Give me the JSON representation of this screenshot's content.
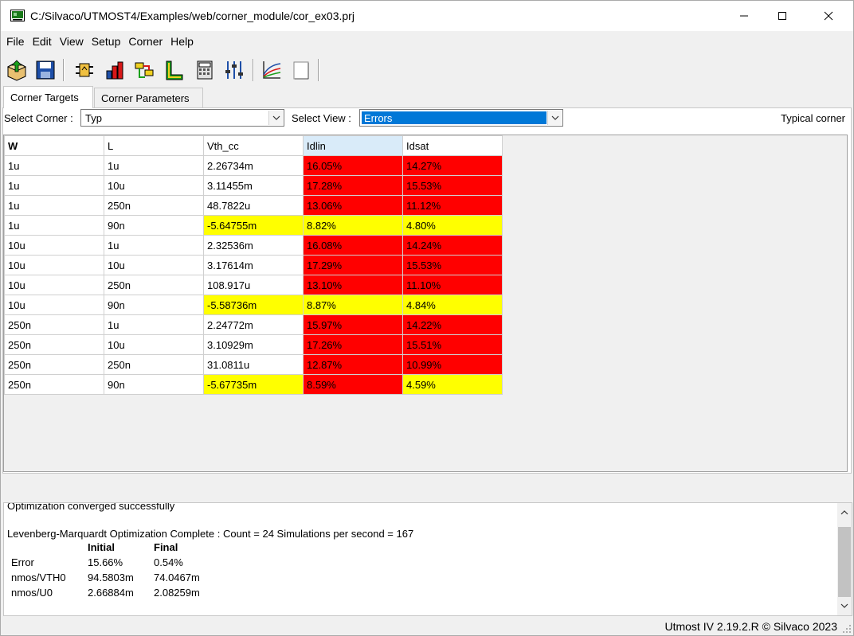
{
  "window": {
    "title": "C:/Silvaco/UTMOST4/Examples/web/corner_module/cor_ex03.prj"
  },
  "menu": [
    "File",
    "Edit",
    "View",
    "Setup",
    "Corner",
    "Help"
  ],
  "toolbar": {
    "icons": [
      "open-project-icon",
      "save-icon",
      "module-icon",
      "bar-chart-icon",
      "flow-icon",
      "l-shape-icon",
      "calculator-icon",
      "sliders-icon",
      "plot-icon",
      "blank-page-icon"
    ]
  },
  "tabs": [
    {
      "label": "Corner Targets",
      "active": true
    },
    {
      "label": "Corner Parameters",
      "active": false
    }
  ],
  "select_corner": {
    "label": "Select Corner :",
    "value": "Typ"
  },
  "select_view": {
    "label": "Select View :",
    "value": "Errors"
  },
  "typical_corner_label": "Typical corner",
  "grid": {
    "headers": [
      "W",
      "L",
      "Vth_cc",
      "Idlin",
      "Idsat"
    ],
    "rows": [
      {
        "cells": [
          "1u",
          "1u",
          "2.26734m",
          "16.05%",
          "14.27%"
        ],
        "colors": [
          "",
          "",
          "",
          "red",
          "red"
        ]
      },
      {
        "cells": [
          "1u",
          "10u",
          "3.11455m",
          "17.28%",
          "15.53%"
        ],
        "colors": [
          "",
          "",
          "",
          "red",
          "red"
        ]
      },
      {
        "cells": [
          "1u",
          "250n",
          "48.7822u",
          "13.06%",
          "11.12%"
        ],
        "colors": [
          "",
          "",
          "",
          "red",
          "red"
        ]
      },
      {
        "cells": [
          "1u",
          "90n",
          "-5.64755m",
          "8.82%",
          "4.80%"
        ],
        "colors": [
          "",
          "",
          "yellow",
          "yellow",
          "yellow"
        ]
      },
      {
        "cells": [
          "10u",
          "1u",
          "2.32536m",
          "16.08%",
          "14.24%"
        ],
        "colors": [
          "",
          "",
          "",
          "red",
          "red"
        ]
      },
      {
        "cells": [
          "10u",
          "10u",
          "3.17614m",
          "17.29%",
          "15.53%"
        ],
        "colors": [
          "",
          "",
          "",
          "red",
          "red"
        ]
      },
      {
        "cells": [
          "10u",
          "250n",
          "108.917u",
          "13.10%",
          "11.10%"
        ],
        "colors": [
          "",
          "",
          "",
          "red",
          "red"
        ]
      },
      {
        "cells": [
          "10u",
          "90n",
          "-5.58736m",
          "8.87%",
          "4.84%"
        ],
        "colors": [
          "",
          "",
          "yellow",
          "yellow",
          "yellow"
        ]
      },
      {
        "cells": [
          "250n",
          "1u",
          "2.24772m",
          "15.97%",
          "14.22%"
        ],
        "colors": [
          "",
          "",
          "",
          "red",
          "red"
        ]
      },
      {
        "cells": [
          "250n",
          "10u",
          "3.10929m",
          "17.26%",
          "15.51%"
        ],
        "colors": [
          "",
          "",
          "",
          "red",
          "red"
        ]
      },
      {
        "cells": [
          "250n",
          "250n",
          "31.0811u",
          "12.87%",
          "10.99%"
        ],
        "colors": [
          "",
          "",
          "",
          "red",
          "red"
        ]
      },
      {
        "cells": [
          "250n",
          "90n",
          "-5.67735m",
          "8.59%",
          "4.59%"
        ],
        "colors": [
          "",
          "",
          "yellow",
          "red",
          "yellow"
        ]
      }
    ]
  },
  "log": {
    "partial_line": "Optimization converged successfully",
    "summary": "Levenberg-Marquardt Optimization Complete : Count = 24  Simulations per second = 167",
    "col_initial": "Initial",
    "col_final": "Final",
    "rows": [
      {
        "name": "Error",
        "initial": "15.66%",
        "final": "0.54%"
      },
      {
        "name": "nmos/VTH0",
        "initial": "94.5803m",
        "final": "74.0467m"
      },
      {
        "name": "nmos/U0",
        "initial": "2.66884m",
        "final": "2.08259m"
      }
    ]
  },
  "status": "Utmost IV 2.19.2.R © Silvaco 2023",
  "colors": {
    "error_red": "#ff0000",
    "warn_yellow": "#ffff00",
    "selection_blue": "#0078d7"
  }
}
